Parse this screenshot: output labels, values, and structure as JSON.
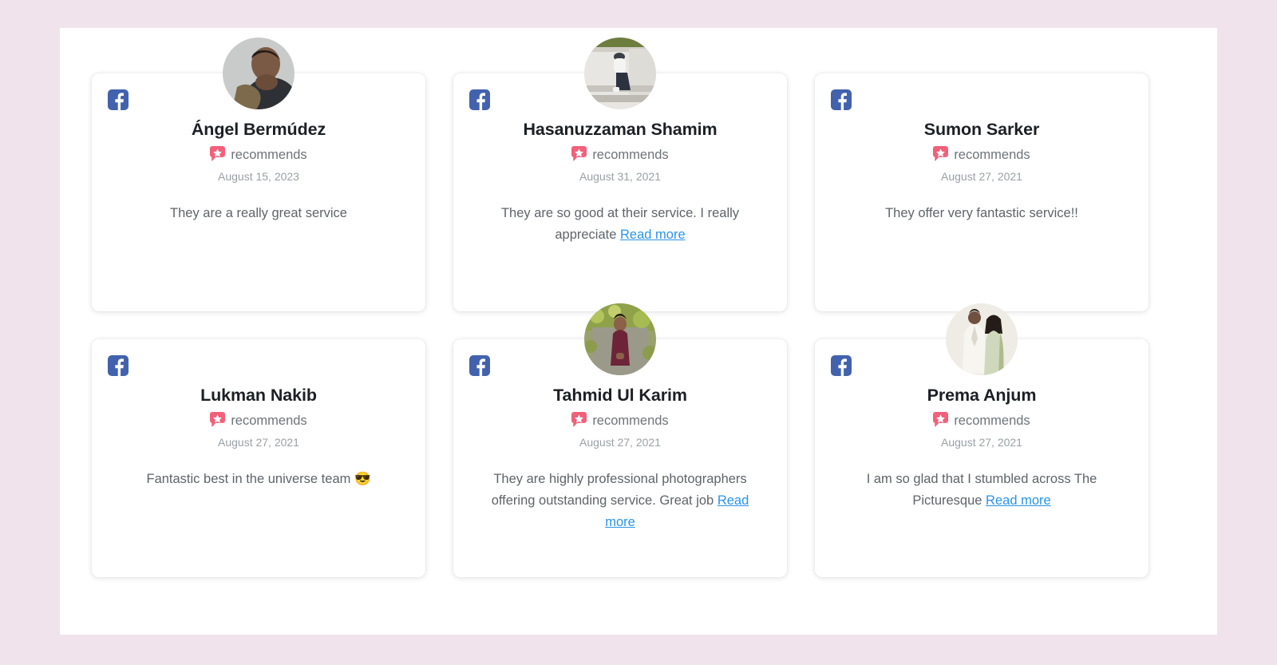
{
  "theme": {
    "page_background": "#f1e3ec",
    "panel_background": "#ffffff",
    "card_background": "#ffffff",
    "facebook_blue": "#4262ad",
    "recommend_pink": "#f2607a",
    "link_blue": "#2a94e8",
    "name_color": "#1c2024",
    "body_text_color": "#5f6469",
    "date_color": "#9aa0a6",
    "broken_image_color": "#fb0007"
  },
  "widget": {
    "source_icon": "facebook-icon",
    "recommend_icon": "recommend-badge-icon",
    "read_more_label": "Read more"
  },
  "reviews": [
    {
      "name": "Ángel Bermúdez",
      "recommends_label": "recommends",
      "date": "August 15, 2023",
      "text": "They are a really great service",
      "has_read_more": false,
      "avatar": "photo",
      "avatar_name": "avatar-angel-bermudez"
    },
    {
      "name": "Hasanuzzaman Shamim",
      "recommends_label": "recommends",
      "date": "August 31, 2021",
      "text": "They are so good at their service. I really appreciate ",
      "has_read_more": true,
      "avatar": "photo",
      "avatar_name": "avatar-hasanuzzaman-shamim"
    },
    {
      "name": "Sumon Sarker",
      "recommends_label": "recommends",
      "date": "August 27, 2021",
      "text": "They offer very fantastic service!!",
      "has_read_more": false,
      "avatar": "broken",
      "avatar_name": "avatar-sumon-sarker"
    },
    {
      "name": "Lukman Nakib",
      "recommends_label": "recommends",
      "date": "August 27, 2021",
      "text": "Fantastic best in the universe team 😎",
      "has_read_more": false,
      "avatar": "broken",
      "avatar_name": "avatar-lukman-nakib"
    },
    {
      "name": "Tahmid Ul Karim",
      "recommends_label": "recommends",
      "date": "August 27, 2021",
      "text": "They are highly professional photographers offering outstanding service. Great job ",
      "has_read_more": true,
      "avatar": "photo",
      "avatar_name": "avatar-tahmid-ul-karim"
    },
    {
      "name": "Prema Anjum",
      "recommends_label": "recommends",
      "date": "August 27, 2021",
      "text": "I am so glad that I stumbled across The Picturesque ",
      "has_read_more": true,
      "avatar": "photo",
      "avatar_name": "avatar-prema-anjum"
    }
  ]
}
